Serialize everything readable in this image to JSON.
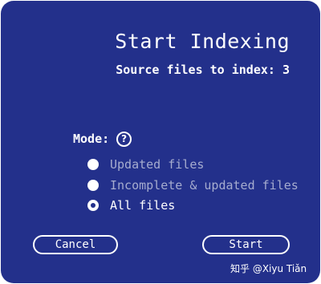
{
  "dialog": {
    "title": "Start Indexing",
    "subtitle": "Source files to index: 3"
  },
  "mode": {
    "label": "Mode:",
    "help_icon": "question-circle-icon",
    "help_glyph": "?",
    "selected": "All files",
    "options": [
      {
        "label": "Updated files",
        "checked": false,
        "enabled": false
      },
      {
        "label": "Incomplete & updated files",
        "checked": false,
        "enabled": false
      },
      {
        "label": "All files",
        "checked": true,
        "enabled": true
      }
    ]
  },
  "buttons": {
    "cancel_label": "Cancel",
    "start_label": "Start"
  },
  "watermark": {
    "text": "知乎 @Xiyu Tiǎn"
  },
  "colors": {
    "background": "#23308b",
    "text": "#ffffff",
    "disabled_text": "#a6accf"
  }
}
